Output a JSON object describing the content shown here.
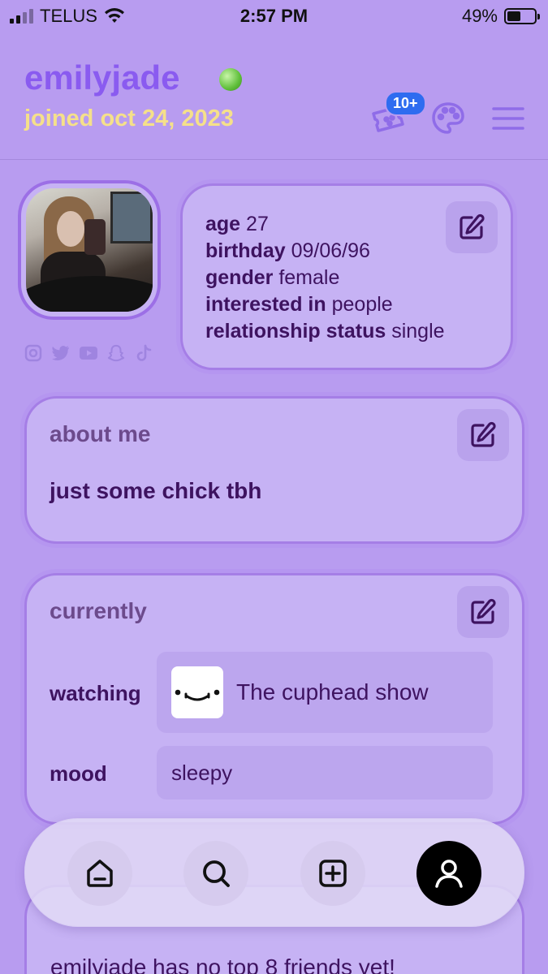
{
  "status_bar": {
    "carrier": "TELUS",
    "time": "2:57 PM",
    "battery": "49%",
    "battery_level": 0.49
  },
  "header": {
    "username": "emilyjade",
    "joined": "joined oct 24, 2023",
    "badge": "10+",
    "online": true,
    "icons": [
      "ticket-icon",
      "palette-icon",
      "menu-icon"
    ]
  },
  "profile": {
    "social_icons": [
      "instagram-icon",
      "twitter-icon",
      "youtube-icon",
      "snapchat-icon",
      "tiktok-icon"
    ],
    "details": [
      {
        "label": "age",
        "value": "27"
      },
      {
        "label": "birthday",
        "value": "09/06/96"
      },
      {
        "label": "gender",
        "value": "female"
      },
      {
        "label": "interested in",
        "value": "people"
      },
      {
        "label": "relationship status",
        "value": "single"
      }
    ]
  },
  "about": {
    "title": "about me",
    "text": "just some chick tbh"
  },
  "currently": {
    "title": "currently",
    "watching_label": "watching",
    "watching_value": "The cuphead show",
    "mood_label": "mood",
    "mood_value": "sleepy"
  },
  "nav": {
    "items": [
      "home-icon",
      "search-icon",
      "add-icon",
      "profile-icon"
    ],
    "active": "profile-icon"
  },
  "friends": {
    "text": "emilyjade has no top 8 friends yet!"
  },
  "colors": {
    "background": "#b89cf0",
    "username": "#8a5bf0",
    "joined": "#f5e08a",
    "text": "#3e1360",
    "badge": "#2e6cf0",
    "online": "#5fbf3a"
  }
}
